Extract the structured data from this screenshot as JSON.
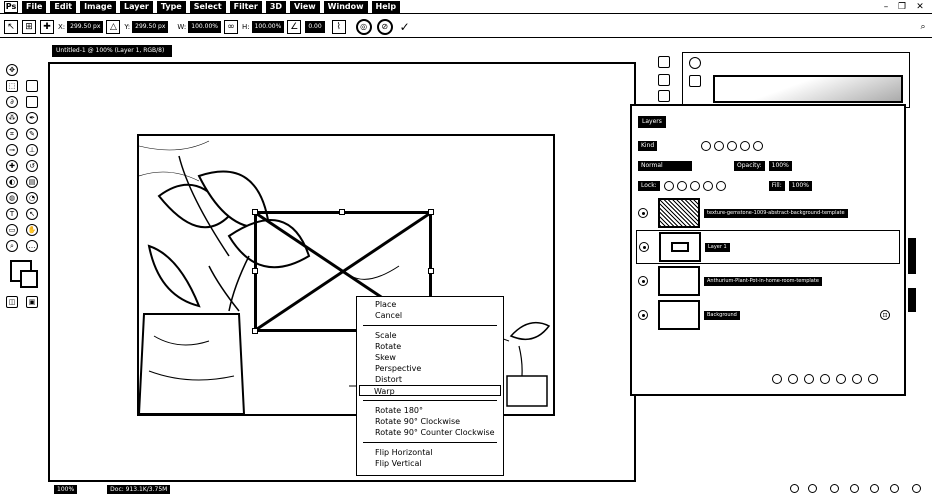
{
  "menubar": {
    "logo": "Ps",
    "items": [
      "File",
      "Edit",
      "Image",
      "Layer",
      "Type",
      "Select",
      "Filter",
      "3D",
      "View",
      "Window",
      "Help"
    ]
  },
  "options": {
    "x_value": "299.50 px",
    "y_value": "299.50 px",
    "w_value": "100.00%",
    "h_value": "100.00%",
    "angle_value": "0.00"
  },
  "document": {
    "tab_label": "Untitled-1 @ 100% (Layer 1, RGB/8)"
  },
  "context_menu": {
    "group1": [
      "Place",
      "Cancel"
    ],
    "group2": [
      "Scale",
      "Rotate",
      "Skew",
      "Perspective",
      "Distort",
      "Warp"
    ],
    "group3": [
      "Rotate 180°",
      "Rotate 90° Clockwise",
      "Rotate 90° Counter Clockwise"
    ],
    "group4": [
      "Flip Horizontal",
      "Flip Vertical"
    ]
  },
  "layers": {
    "title": "Layers",
    "kind_label": "Kind",
    "blend_mode": "Normal",
    "opacity_label": "Opacity:",
    "opacity_value": "100%",
    "lock_label": "Lock:",
    "fill_label": "Fill:",
    "fill_value": "100%",
    "rows": [
      {
        "name": "texture-gemstone-1009-abstract-background-template"
      },
      {
        "name": "Layer 1"
      },
      {
        "name": "Anthurium-Plant-Pot-in-home-room-template"
      },
      {
        "name": "Background"
      }
    ]
  },
  "statusbar": {
    "zoom": "100%",
    "doc_info": "Doc: 913.1K/3.75M"
  }
}
